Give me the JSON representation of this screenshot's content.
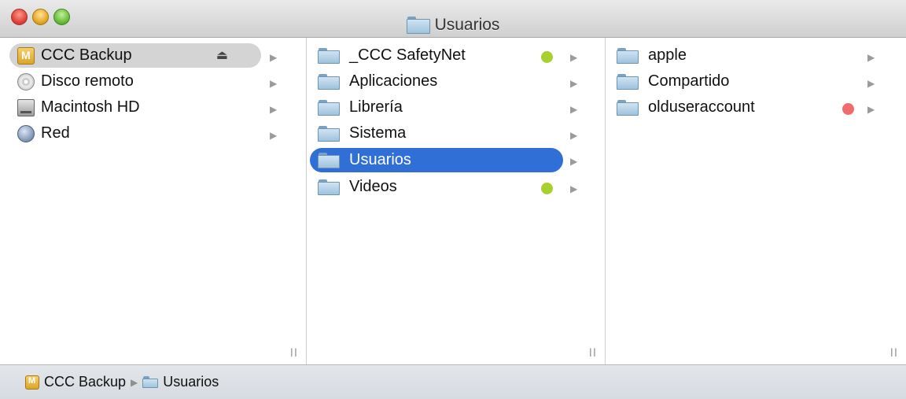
{
  "window": {
    "title": "Usuarios",
    "traffic_lights": [
      "close",
      "minimize",
      "zoom"
    ]
  },
  "column1": {
    "items": [
      {
        "label": "CCC Backup",
        "icon": "backup-volume-icon",
        "selected": true,
        "eject": "⏏"
      },
      {
        "label": "Disco remoto",
        "icon": "remote-disc-icon"
      },
      {
        "label": "Macintosh HD",
        "icon": "hard-drive-icon"
      },
      {
        "label": "Red",
        "icon": "network-icon"
      }
    ]
  },
  "column2": {
    "items": [
      {
        "label": "_CCC SafetyNet",
        "icon": "folder-icon",
        "tag_color": "#a7d12e"
      },
      {
        "label": "Aplicaciones",
        "icon": "folder-icon"
      },
      {
        "label": "Librería",
        "icon": "folder-icon"
      },
      {
        "label": "Sistema",
        "icon": "folder-icon"
      },
      {
        "label": "Usuarios",
        "icon": "folder-icon",
        "selected": true
      },
      {
        "label": "Videos",
        "icon": "folder-icon",
        "tag_color": "#a7d12e"
      }
    ]
  },
  "column3": {
    "items": [
      {
        "label": "apple",
        "icon": "folder-icon"
      },
      {
        "label": "Compartido",
        "icon": "folder-icon"
      },
      {
        "label": "olduseraccount",
        "icon": "folder-icon",
        "tag_color": "#ee6b6e"
      }
    ]
  },
  "pathbar": {
    "segments": [
      {
        "label": "CCC Backup",
        "icon": "backup-volume-icon"
      },
      {
        "label": "Usuarios",
        "icon": "folder-icon"
      }
    ]
  },
  "colors": {
    "selection_blue": "#2f6fd6",
    "selection_gray": "#d4d4d4"
  }
}
